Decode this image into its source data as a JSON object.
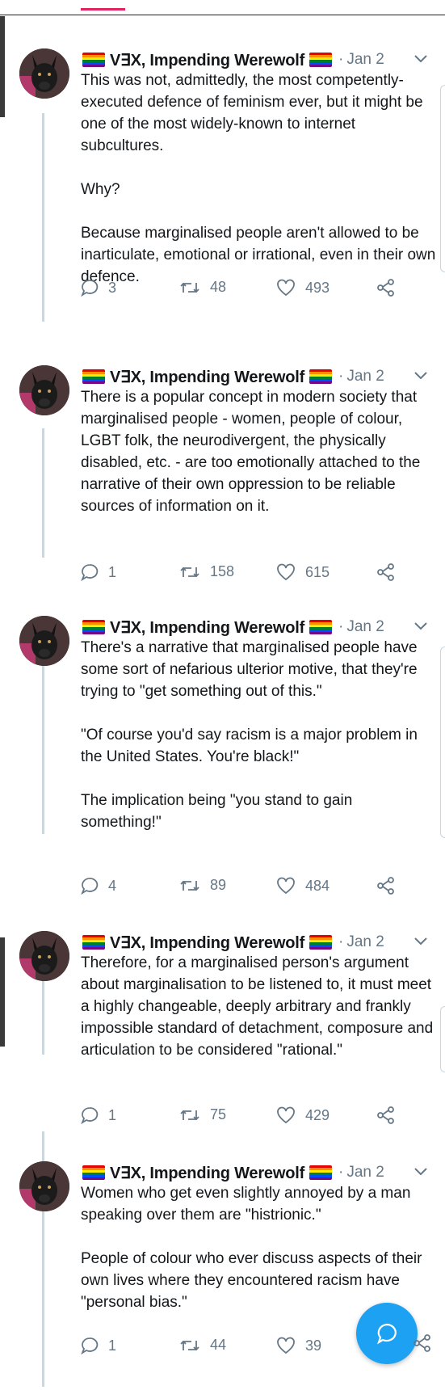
{
  "author": {
    "display_name": "V∃X, Impending Werewolf"
  },
  "tweets": [
    {
      "date": "Jan 2",
      "text": "This was not, admittedly, the most competently-executed defence of feminism ever, but it might be one of the most widely-known to internet subcultures.\n\nWhy?\n\nBecause marginalised people aren't allowed to be inarticulate, emotional or irrational, even in their own defence.",
      "replies": "3",
      "retweets": "48",
      "likes": "493"
    },
    {
      "date": "Jan 2",
      "text": "There is a popular concept in modern society that marginalised people - women, people of colour, LGBT folk, the neurodivergent, the physically disabled, etc. - are too emotionally attached to the narrative of their own oppression to be reliable sources of information on it.",
      "replies": "1",
      "retweets": "158",
      "likes": "615"
    },
    {
      "date": "Jan 2",
      "text": "There's a narrative that marginalised people have some sort of nefarious ulterior motive, that they're trying to \"get something out of this.\"\n\n\"Of course you'd say racism is a major problem in the United States. You're black!\"\n\nThe implication being \"you stand to gain something!\"",
      "replies": "4",
      "retweets": "89",
      "likes": "484"
    },
    {
      "date": "Jan 2",
      "text": "Therefore, for a marginalised person's argument about marginalisation to be listened to, it must meet a highly changeable, deeply arbitrary and frankly impossible standard of detachment, composure and articulation to be considered \"rational.\"",
      "replies": "1",
      "retweets": "75",
      "likes": "429"
    },
    {
      "date": "Jan 2",
      "text": "Women who get even slightly annoyed by a man speaking over them are \"histrionic.\"\n\nPeople of colour who ever discuss aspects of their own lives where they encountered racism have \"personal bias.\"",
      "replies": "1",
      "retweets": "44",
      "likes": "39"
    }
  ],
  "colors": {
    "accent": "#1da1f2",
    "muted": "#657786",
    "thread_line": "#ccd6dd"
  }
}
